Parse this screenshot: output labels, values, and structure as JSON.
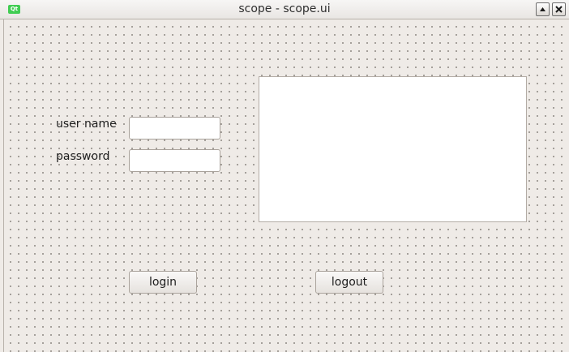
{
  "window": {
    "title": "scope - scope.ui",
    "app_icon": "qt-logo-icon",
    "app_icon_text": "Qt",
    "controls": [
      "shade-icon",
      "close-icon"
    ]
  },
  "form": {
    "username_label": "user name",
    "username_value": "",
    "password_label": "password",
    "password_value": "",
    "output_text": "",
    "login_label": "login",
    "logout_label": "logout"
  },
  "colors": {
    "background": "#efebe7",
    "field_background": "#ffffff",
    "qt_green": "#41cd52"
  }
}
